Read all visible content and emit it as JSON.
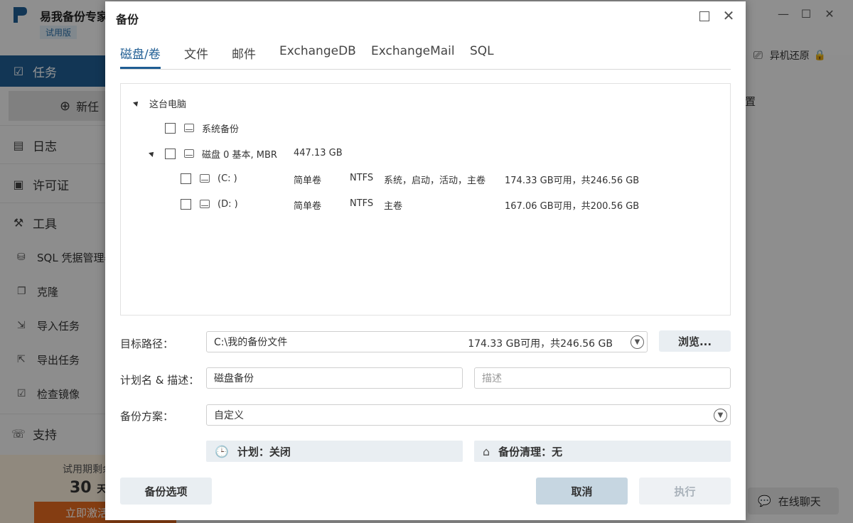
{
  "app": {
    "title": "易我备份专家",
    "edition": "试用版",
    "controls": {
      "minimize": "—",
      "maximize": "☐",
      "close": "✕"
    },
    "sidebar": {
      "tasks": "任务",
      "new_task": "新任",
      "log": "日志",
      "license": "许可证",
      "tools": "工具",
      "tool_items": [
        "SQL 凭据管理器",
        "克隆",
        "导入任务",
        "导出任务",
        "检查镜像"
      ],
      "support": "支持"
    },
    "trial": {
      "line1": "试用期剩余",
      "days": "30",
      "unit": "天",
      "activate": "立即激活"
    },
    "restore": "异机还原",
    "settings_fragment": "置",
    "chat": "在线聊天"
  },
  "dialog": {
    "title": "备份",
    "close": "✕",
    "tabs": [
      "磁盘/卷",
      "文件",
      "邮件",
      "ExchangeDB",
      "ExchangeMail",
      "SQL"
    ],
    "tree": {
      "root": "这台电脑",
      "system_backup": "系统备份",
      "disk": {
        "name": "磁盘 0 基本, MBR",
        "size": "447.13 GB"
      },
      "partitions": [
        {
          "name": "(C: )",
          "type": "简单卷",
          "fs": "NTFS",
          "flags": "系统，启动，活动，主卷",
          "space": "174.33 GB可用，共246.56 GB"
        },
        {
          "name": "(D: )",
          "type": "简单卷",
          "fs": "NTFS",
          "flags": "主卷",
          "space": "167.06 GB可用，共200.56 GB"
        }
      ]
    },
    "target": {
      "label": "目标路径：",
      "value": "C:\\我的备份文件",
      "free": "174.33 GB可用，共246.56 GB",
      "browse": "浏览..."
    },
    "plan": {
      "label": "计划名 & 描述：",
      "name": "磁盘备份",
      "desc_placeholder": "描述"
    },
    "scheme": {
      "label": "备份方案：",
      "value": "自定义"
    },
    "schedule": {
      "text": "计划：关闭"
    },
    "cleanup": {
      "text": "备份清理：无"
    },
    "buttons": {
      "options": "备份选项",
      "cancel": "取消",
      "execute": "执行"
    }
  }
}
